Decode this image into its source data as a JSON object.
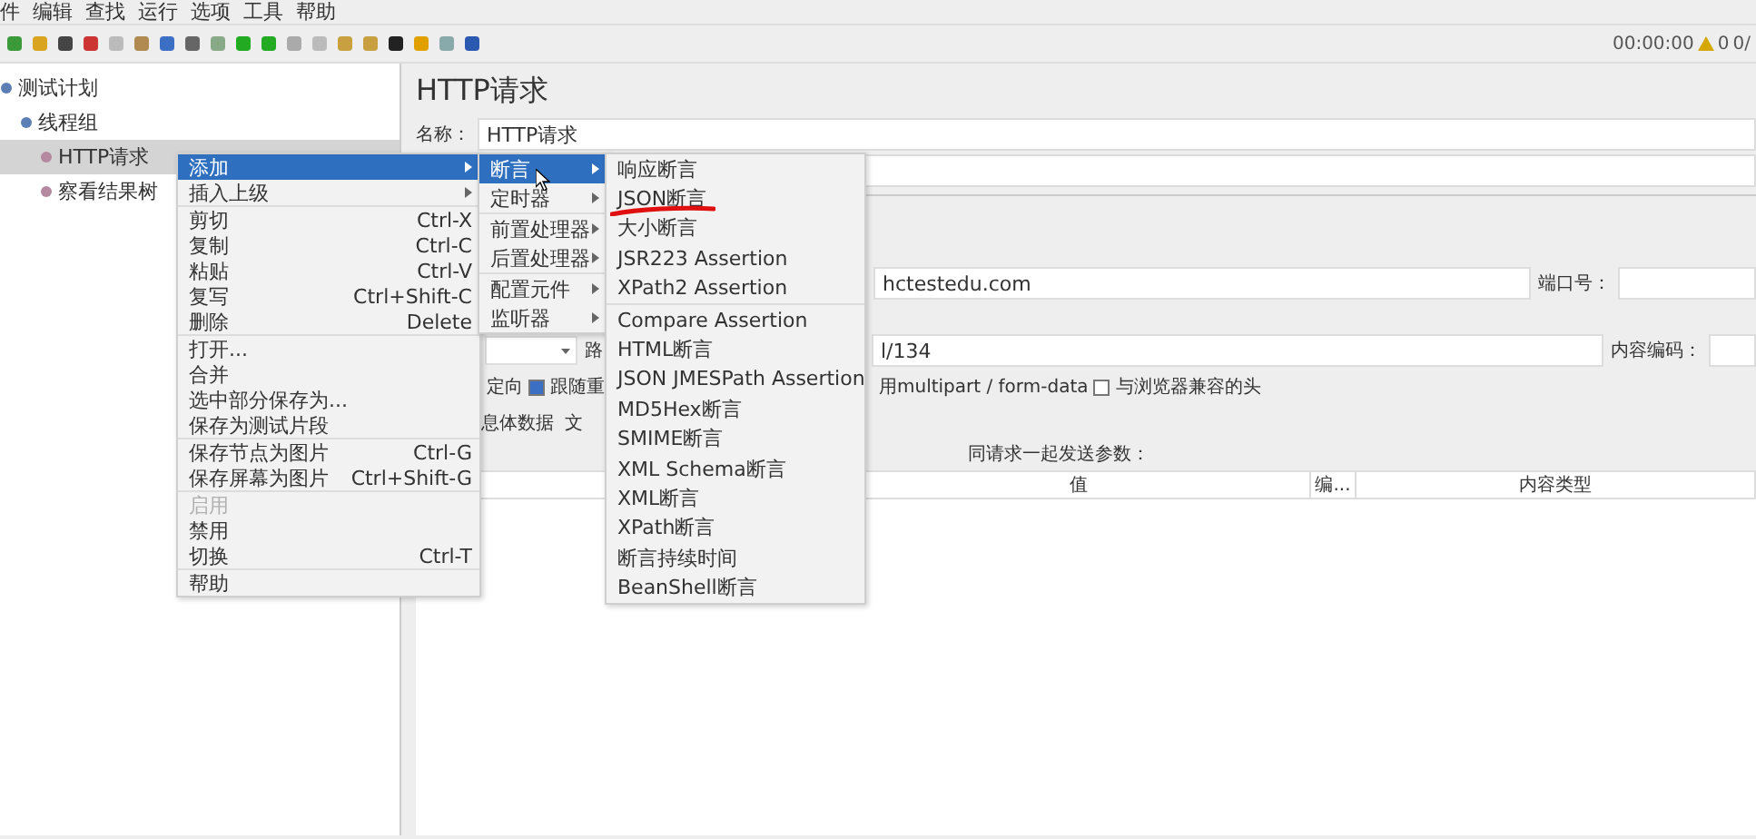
{
  "menubar": [
    "件",
    "编辑",
    "查找",
    "运行",
    "选项",
    "工具",
    "帮助"
  ],
  "status": {
    "time": "00:00:00",
    "warnings": "0",
    "threads": "0/"
  },
  "tree": [
    {
      "label": "测试计划",
      "selected": false,
      "children": [
        {
          "label": "线程组",
          "selected": false,
          "children": [
            {
              "label": "HTTP请求",
              "selected": true
            },
            {
              "label": "察看结果树",
              "selected": false
            }
          ]
        }
      ]
    }
  ],
  "panel": {
    "title": "HTTP请求",
    "name_label": "名称：",
    "name_value": "HTTP请求",
    "server_value": "hctestedu.com",
    "port_label": "端口号：",
    "path_label": "路",
    "path_value": "l/134",
    "encoding_label": "内容编码：",
    "options": [
      {
        "label": "定向",
        "kind": "text"
      },
      {
        "label": "跟随重",
        "kind": "checkbox",
        "checked": true
      },
      {
        "label": "用multipart / form-data",
        "kind": "text"
      },
      {
        "label": "与浏览器兼容的头",
        "kind": "checkbox",
        "checked": false
      }
    ],
    "body_tabs": [
      "息体数据",
      "文"
    ],
    "params_title": "同请求一起发送参数：",
    "columns": [
      "值",
      "编...",
      "内容类型"
    ]
  },
  "context_menu": [
    [
      {
        "label": "添加",
        "submenu": true,
        "selected": true
      },
      {
        "label": "插入上级",
        "submenu": true,
        "selected": false
      }
    ],
    [
      {
        "label": "剪切",
        "shortcut": "Ctrl-X",
        "selected": false
      },
      {
        "label": "复制",
        "shortcut": "Ctrl-C",
        "selected": false
      },
      {
        "label": "粘贴",
        "shortcut": "Ctrl-V",
        "selected": false
      },
      {
        "label": "复写",
        "shortcut": "Ctrl+Shift-C",
        "selected": false
      },
      {
        "label": "删除",
        "shortcut": "Delete",
        "selected": false
      }
    ],
    [
      {
        "label": "打开...",
        "selected": false
      },
      {
        "label": "合并",
        "selected": false
      },
      {
        "label": "选中部分保存为...",
        "selected": false
      },
      {
        "label": "保存为测试片段",
        "selected": false
      }
    ],
    [
      {
        "label": "保存节点为图片",
        "shortcut": "Ctrl-G",
        "selected": false
      },
      {
        "label": "保存屏幕为图片",
        "shortcut": "Ctrl+Shift-G",
        "selected": false
      }
    ],
    [
      {
        "label": "启用",
        "selected": false,
        "disabled": true
      },
      {
        "label": "禁用",
        "selected": false
      },
      {
        "label": "切换",
        "shortcut": "Ctrl-T",
        "selected": false
      }
    ],
    [
      {
        "label": "帮助",
        "selected": false
      }
    ]
  ],
  "add_submenu": [
    [
      {
        "label": "断言",
        "submenu": true,
        "selected": true
      },
      {
        "label": "定时器",
        "submenu": true,
        "selected": false
      }
    ],
    [
      {
        "label": "前置处理器",
        "submenu": true,
        "selected": false
      },
      {
        "label": "后置处理器",
        "submenu": true,
        "selected": false
      }
    ],
    [
      {
        "label": "配置元件",
        "submenu": true,
        "selected": false
      },
      {
        "label": "监听器",
        "submenu": true,
        "selected": false
      }
    ]
  ],
  "assertion_submenu": [
    [
      {
        "label": "响应断言",
        "selected": false
      },
      {
        "label": "JSON断言",
        "selected": false,
        "annotated": true
      },
      {
        "label": "大小断言",
        "selected": false
      },
      {
        "label": "JSR223 Assertion",
        "selected": false
      },
      {
        "label": "XPath2 Assertion",
        "selected": false
      }
    ],
    [
      {
        "label": "Compare Assertion",
        "selected": false
      },
      {
        "label": "HTML断言",
        "selected": false
      },
      {
        "label": "JSON JMESPath Assertion",
        "selected": false
      },
      {
        "label": "MD5Hex断言",
        "selected": false
      },
      {
        "label": "SMIME断言",
        "selected": false
      },
      {
        "label": "XML Schema断言",
        "selected": false
      },
      {
        "label": "XML断言",
        "selected": false
      },
      {
        "label": "XPath断言",
        "selected": false
      },
      {
        "label": "断言持续时间",
        "selected": false
      },
      {
        "label": "BeanShell断言",
        "selected": false
      }
    ]
  ]
}
